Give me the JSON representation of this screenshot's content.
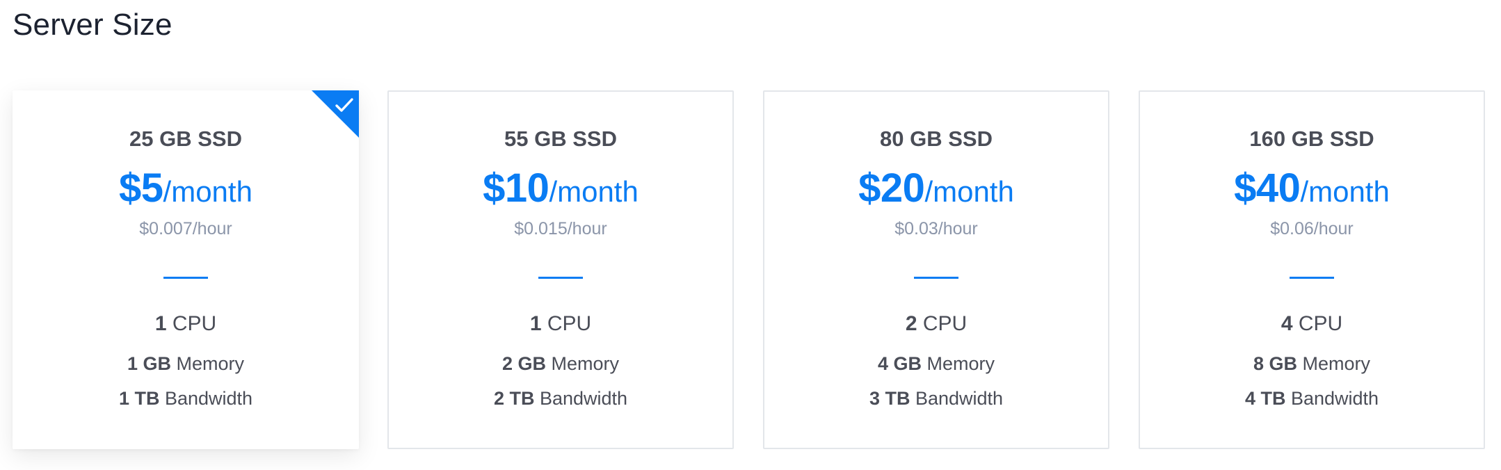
{
  "title": "Server Size",
  "colors": {
    "accent": "#0a7cf3",
    "text": "#4a4d57",
    "muted": "#8b95a9",
    "border": "#e3e6ea"
  },
  "selected_plan_index": 0,
  "plans": [
    {
      "disk": "25 GB SSD",
      "price": "$5",
      "period": "/month",
      "hourly": "$0.007/hour",
      "cpu_value": "1",
      "cpu_label": "CPU",
      "memory_value": "1 GB",
      "memory_label": "Memory",
      "bandwidth_value": "1 TB",
      "bandwidth_label": "Bandwidth",
      "selected": true,
      "selected_icon": "check-icon"
    },
    {
      "disk": "55 GB SSD",
      "price": "$10",
      "period": "/month",
      "hourly": "$0.015/hour",
      "cpu_value": "1",
      "cpu_label": "CPU",
      "memory_value": "2 GB",
      "memory_label": "Memory",
      "bandwidth_value": "2 TB",
      "bandwidth_label": "Bandwidth",
      "selected": false
    },
    {
      "disk": "80 GB SSD",
      "price": "$20",
      "period": "/month",
      "hourly": "$0.03/hour",
      "cpu_value": "2",
      "cpu_label": "CPU",
      "memory_value": "4 GB",
      "memory_label": "Memory",
      "bandwidth_value": "3 TB",
      "bandwidth_label": "Bandwidth",
      "selected": false
    },
    {
      "disk": "160 GB SSD",
      "price": "$40",
      "period": "/month",
      "hourly": "$0.06/hour",
      "cpu_value": "4",
      "cpu_label": "CPU",
      "memory_value": "8 GB",
      "memory_label": "Memory",
      "bandwidth_value": "4 TB",
      "bandwidth_label": "Bandwidth",
      "selected": false
    }
  ]
}
